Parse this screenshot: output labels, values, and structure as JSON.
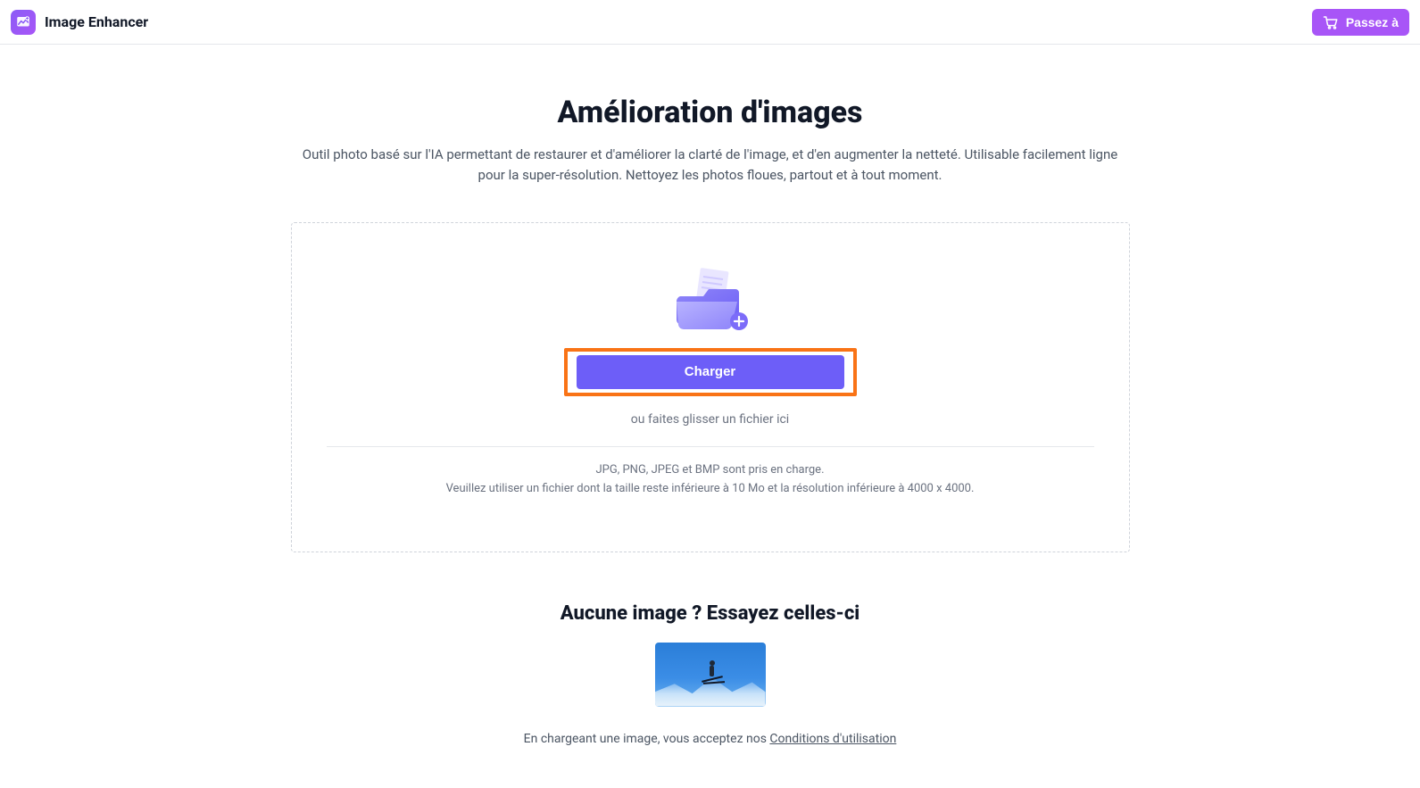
{
  "header": {
    "app_title": "Image Enhancer",
    "upgrade_label": "Passez à"
  },
  "hero": {
    "title": "Amélioration d'images",
    "subtitle": "Outil photo basé sur l'IA permettant de restaurer et d'améliorer la clarté de l'image, et d'en augmenter la netteté. Utilisable facilement ligne pour la super-résolution. Nettoyez les photos floues, partout et à tout moment."
  },
  "dropzone": {
    "upload_button": "Charger",
    "drag_hint": "ou faites glisser un fichier ici",
    "supported_formats": "JPG, PNG, JPEG et BMP sont pris en charge.",
    "limits": "Veuillez utiliser un fichier dont la taille reste inférieure à 10 Mo et la résolution inférieure à 4000 x 4000."
  },
  "samples": {
    "title": "Aucune image ? Essayez celles-ci"
  },
  "terms": {
    "prefix": "En chargeant une image, vous acceptez nos ",
    "link_label": "Conditions d'utilisation"
  }
}
